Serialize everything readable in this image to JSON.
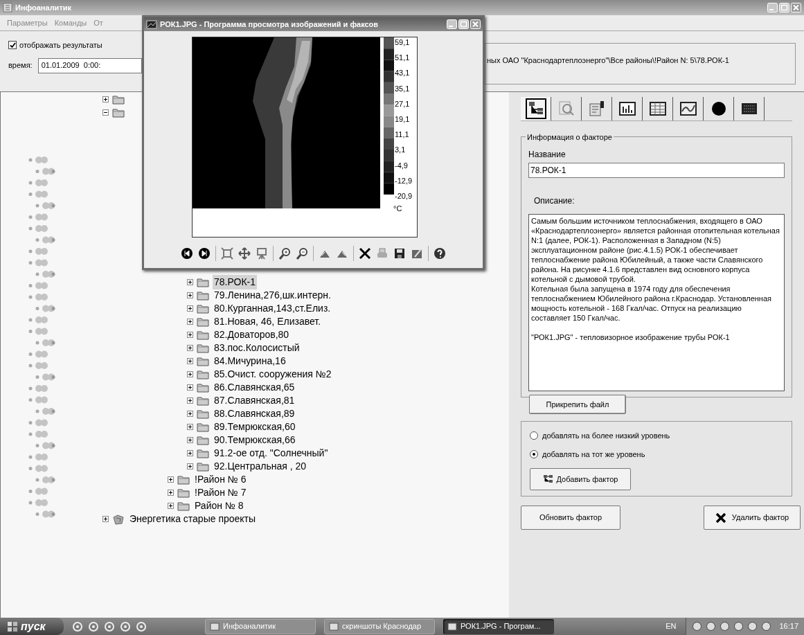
{
  "window": {
    "title": "Инфоаналитик"
  },
  "menu": [
    "Параметры",
    "Команды",
    "От"
  ],
  "display_results": {
    "label": "отображать результаты",
    "checked": true
  },
  "time": {
    "label": "время:",
    "value": "01.01.2009  0:00:"
  },
  "path": "ных ОАО \"Краснодартеплоэнерго\"\\Все районы\\!Район N: 5\\78.РОК-1",
  "tree": {
    "nodes": [
      {
        "expanded": false
      },
      {
        "expanded": true,
        "children": [
          {
            "children": [
              {
                "children": [
                  {
                    "children": [
                      {
                        "label": "78.РОК-1",
                        "selected": true,
                        "expanded": false
                      },
                      {
                        "label": "79.Ленина,276,шк.интерн.",
                        "selected": false,
                        "expanded": false
                      },
                      {
                        "label": "80.Курганная,143,ст.Елиз.",
                        "selected": false,
                        "expanded": false
                      },
                      {
                        "label": "81.Новая, 46, Елизавет.",
                        "selected": false,
                        "expanded": false
                      },
                      {
                        "label": "82.Доваторов,80",
                        "selected": false,
                        "expanded": false
                      },
                      {
                        "label": "83.пос.Колосистый",
                        "selected": false,
                        "expanded": false
                      },
                      {
                        "label": "84.Мичурина,16",
                        "selected": false,
                        "expanded": false
                      },
                      {
                        "label": "85.Очист. сооружения №2",
                        "selected": false,
                        "expanded": false
                      },
                      {
                        "label": "86.Славянская,65",
                        "selected": false,
                        "expanded": false
                      },
                      {
                        "label": "87.Славянская,81",
                        "selected": false,
                        "expanded": false
                      },
                      {
                        "label": "88.Славянская,89",
                        "selected": false,
                        "expanded": false
                      },
                      {
                        "label": "89.Темрюкская,60",
                        "selected": false,
                        "expanded": false
                      },
                      {
                        "label": "90.Темрюкская,66",
                        "selected": false,
                        "expanded": false
                      },
                      {
                        "label": "91.2-ое отд. \"Солнечный\"",
                        "selected": false,
                        "expanded": false
                      },
                      {
                        "label": "92.Центральная , 20",
                        "selected": false,
                        "expanded": false
                      }
                    ]
                  },
                  {
                    "label": "!Район № 6",
                    "selected": false,
                    "expanded": false
                  },
                  {
                    "label": "!Район № 7",
                    "selected": false,
                    "expanded": false
                  },
                  {
                    "label": "Район № 8",
                    "selected": false,
                    "expanded": false
                  }
                ]
              }
            ]
          }
        ]
      },
      {
        "label": "Энергетика старые проекты",
        "kind": "project",
        "selected": false,
        "expanded": false
      }
    ]
  },
  "right_panel": {
    "tabs": [
      {
        "kind": "tree",
        "selected": true
      },
      {
        "kind": "search",
        "selected": false
      },
      {
        "kind": "edit",
        "selected": false
      },
      {
        "kind": "bar-chart",
        "selected": false
      },
      {
        "kind": "table",
        "selected": false
      },
      {
        "kind": "line-chart",
        "selected": false
      },
      {
        "kind": "circle",
        "selected": false
      },
      {
        "kind": "calculator",
        "selected": false
      }
    ],
    "group_title": "Информация о факторе",
    "name_label": "Название",
    "name_value": "78.РОК-1",
    "description_label": "Описание:",
    "description": "Самым большим источником теплоснабжения, входящего в ОАО «Краснодартеплоэнерго» является районная отопительная котельная N:1 (далее, РОК-1). Расположенная в Западном (N:5) эксплуатационном районе (рис.4.1.5) РОК-1 обеспечивает теплоснабжение района Юбилейный, а также части Славянского района. На рисунке 4.1.6 представлен вид основного корпуса котельной с дымовой трубой.\nКотельная была запущена в 1974 году для обеспечения теплоснабжением Юбилейного района г.Краснодар. Установленная мощность котельной - 168 Гкал/час. Отпуск на реализацию составляет 150 Гкал/час.\n\n\"РОК1.JPG\" - тепловизорное изображение трубы РОК-1",
    "attach_button": "Прикрепить файл",
    "options": [
      {
        "label": "добавлять на более низкий уровень",
        "selected": false
      },
      {
        "label": "добавлять на тот же уровень",
        "selected": true
      }
    ],
    "add_button": "Добавить фактор",
    "update_button": "Обновить фактор",
    "delete_button": "Удалить фактор"
  },
  "viewer": {
    "title": "РОК1.JPG - Программа просмотра изображений и факсов",
    "scale_labels": [
      "59,1",
      "51,1",
      "43,1",
      "35,1",
      "27,1",
      "19,1",
      "11,1",
      "3,1",
      "-4,9",
      "-12,9",
      "-20,9"
    ],
    "unit": "°C"
  },
  "taskbar": {
    "start": "пуск",
    "tasks": [
      {
        "label": "Инфоаналитик",
        "selected": false
      },
      {
        "label": "скриншоты Краснодар",
        "selected": false
      },
      {
        "label": "РОК1.JPG - Програм...",
        "selected": true
      }
    ],
    "language": "EN",
    "clock": "16:17"
  }
}
